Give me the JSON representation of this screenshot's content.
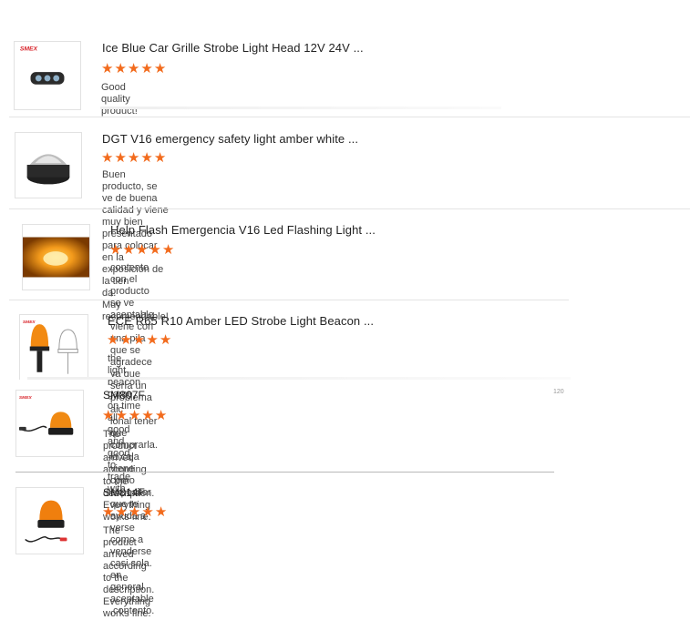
{
  "reviews": [
    {
      "title": "Ice Blue Car Grille Strobe Light Head 12V 24V ...",
      "rating": 5,
      "brand": "SMEX",
      "image": "grille-strobe-light",
      "text_lines": [
        "Good quality product!"
      ]
    },
    {
      "title": "DGT V16 emergency safety light amber white ...",
      "rating": 5,
      "image": "v16-dome-light",
      "text_lines": [
        "Buen producto, se ve de buena calidad y viene muy bien presentado para colocar en la exposición de la tien",
        "da.",
        "Muy recomendable!"
      ]
    },
    {
      "title": "Help Flash Emergencia V16 Led Flashing Light ...",
      "rating": 5,
      "image": "help-flash-glowing-light",
      "text_lines": [
        "contento con  el producto se ve aceptable viene con una pila que se agradece ya que sería un problema aic",
        "ional tener que comprarla. la caja viene como expositor que te ayuda a verse como a venderse casi sola.",
        "en general aceptable ,contento."
      ]
    },
    {
      "title": "ECE R65 R10 Amber LED Strobe Light Beacon ...",
      "rating": 5,
      "brand": "SMEX",
      "image": "amber-beacon-pole",
      "text_lines": [
        "the light beacon game on time all good and good to trade with"
      ]
    },
    {
      "title": "SM807F",
      "rating": 5,
      "brand": "SMEX",
      "image": "magnetic-beacon",
      "text_lines": [
        "The product arrived according to the description. Everything works fine."
      ]
    },
    {
      "title": "SM814F",
      "rating": 5,
      "image": "magnetic-beacon-orange",
      "text_lines": [
        "The product arrived according to the description. Everything works fine."
      ]
    }
  ],
  "colors": {
    "star": "#f26b1d",
    "text": "#444444",
    "divider": "#e3e3e3"
  },
  "star_glyph": "★",
  "fragment_text": "120"
}
